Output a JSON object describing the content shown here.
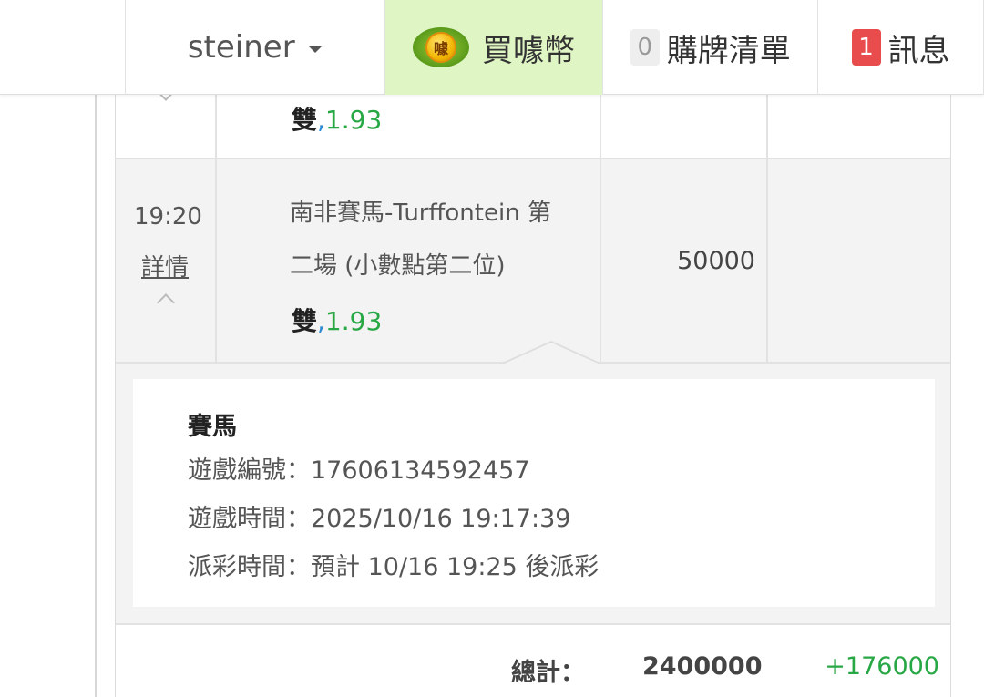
{
  "nav": {
    "username": "steiner",
    "buy_coins_label": "買噱幣",
    "coin_icon_text": "噱",
    "ticket_list_count": "0",
    "ticket_list_label": "購牌清單",
    "messages_count": "1",
    "messages_label": "訊息"
  },
  "bets": {
    "previous": {
      "pick": "雙",
      "separator": ",",
      "odds": "1.93"
    },
    "current": {
      "time": "19:20",
      "detail_label": "詳情",
      "game_line1": "南非賽馬-Turffontein 第",
      "game_line2": "二場 (小數點第二位)",
      "pick": "雙",
      "separator": ",",
      "odds": "1.93",
      "amount": "50000"
    }
  },
  "detail": {
    "title": "賽馬",
    "game_no_label": "遊戲編號：",
    "game_no": "17606134592457",
    "game_time_label": "遊戲時間：",
    "game_time": "2025/10/16 19:17:39",
    "payout_label": "派彩時間：",
    "payout_text": "預計 10/16 19:25 後派彩"
  },
  "total": {
    "label": "總計：",
    "amount": "2400000",
    "win": "+176000"
  },
  "colors": {
    "green": "#28a745",
    "blue": "#2a8bd6",
    "badge_red": "#e84c4c",
    "buy_bg": "#dff5c4"
  }
}
